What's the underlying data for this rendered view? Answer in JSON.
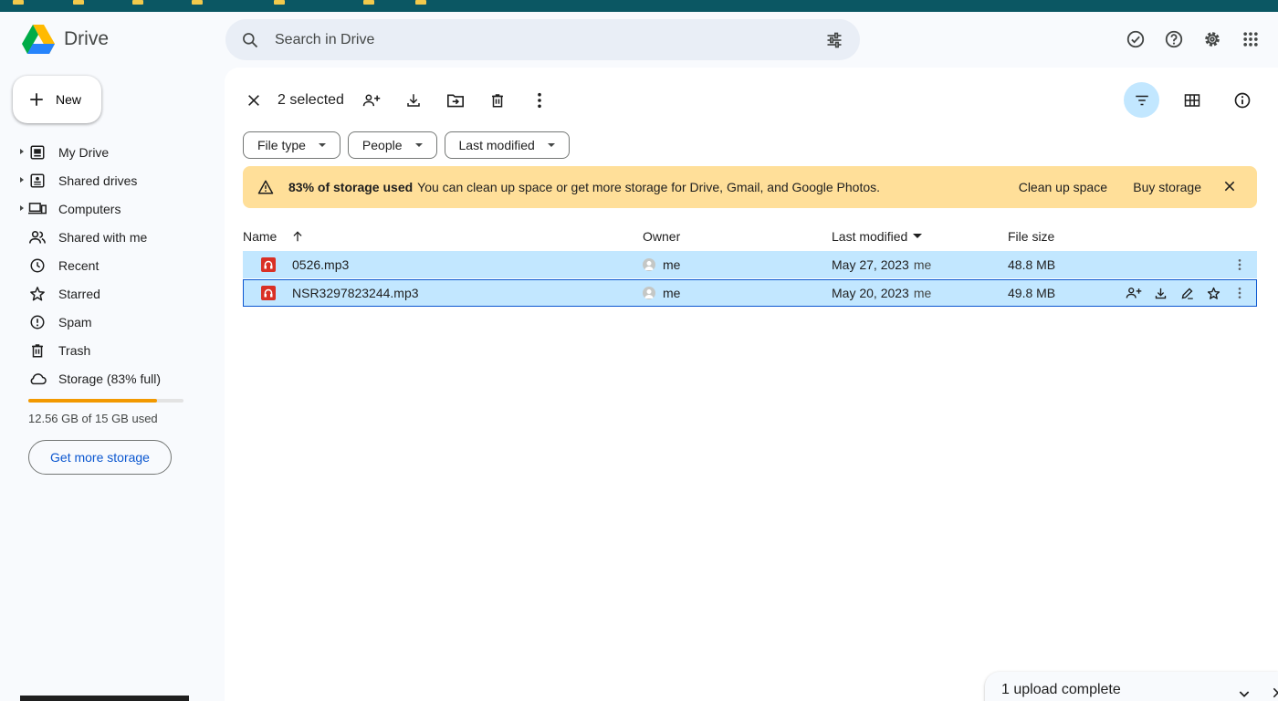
{
  "app": {
    "name": "Drive"
  },
  "search": {
    "placeholder": "Search in Drive"
  },
  "new_button": {
    "label": "New"
  },
  "sidebar": {
    "items": [
      {
        "label": "My Drive",
        "icon": "my-drive-icon",
        "expandable": true
      },
      {
        "label": "Shared drives",
        "icon": "shared-drives-icon",
        "expandable": true
      },
      {
        "label": "Computers",
        "icon": "computers-icon",
        "expandable": true
      },
      {
        "label": "Shared with me",
        "icon": "people-icon",
        "expandable": false
      },
      {
        "label": "Recent",
        "icon": "clock-icon",
        "expandable": false
      },
      {
        "label": "Starred",
        "icon": "star-icon",
        "expandable": false
      },
      {
        "label": "Spam",
        "icon": "spam-icon",
        "expandable": false
      },
      {
        "label": "Trash",
        "icon": "trash-icon",
        "expandable": false
      },
      {
        "label": "Storage (83% full)",
        "icon": "cloud-icon",
        "expandable": false
      }
    ],
    "storage_used_fraction": 0.83,
    "storage_text": "12.56 GB of 15 GB used",
    "get_more_label": "Get more storage"
  },
  "toolbar": {
    "selected_text": "2 selected"
  },
  "filters": [
    "File type",
    "People",
    "Last modified"
  ],
  "banner": {
    "bold": "83% of storage used",
    "message": "You can clean up space or get more storage for Drive, Gmail, and Google Photos.",
    "action1": "Clean up space",
    "action2": "Buy storage"
  },
  "table": {
    "headers": {
      "name": "Name",
      "owner": "Owner",
      "modified": "Last modified",
      "size": "File size"
    },
    "rows": [
      {
        "name": "0526.mp3",
        "owner": "me",
        "modified": "May 27, 2023",
        "modified_by": "me",
        "size": "48.8 MB"
      },
      {
        "name": "NSR3297823244.mp3",
        "owner": "me",
        "modified": "May 20, 2023",
        "modified_by": "me",
        "size": "49.8 MB"
      }
    ]
  },
  "upload": {
    "status": "1 upload complete"
  },
  "colors": {
    "selected_row": "#c2e7ff",
    "banner": "#ffdf99",
    "accent": "#0b57d0",
    "storage_fill": "#f29900"
  }
}
